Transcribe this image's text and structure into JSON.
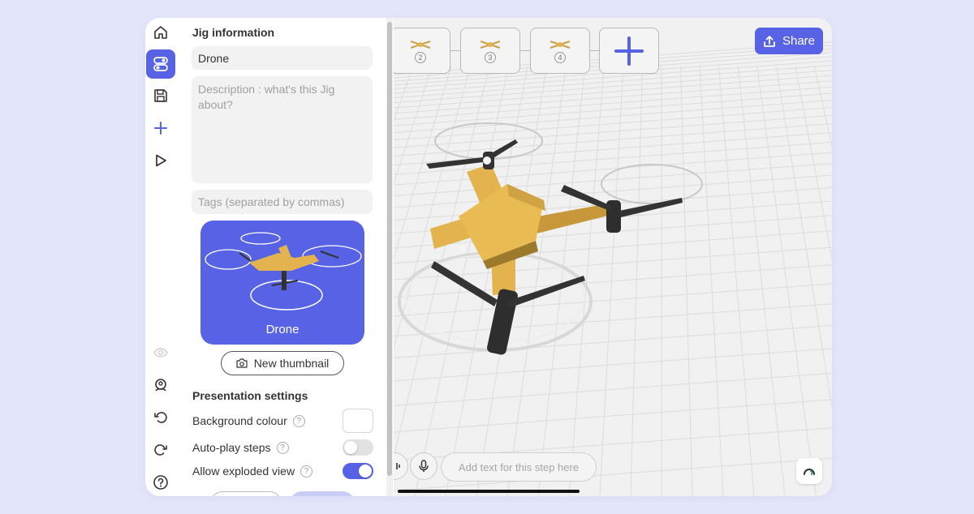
{
  "colors": {
    "accent": "#5763e4",
    "page_bg": "#e3e6fb",
    "drone_body": "#e3b44e"
  },
  "rail": {
    "items": [
      {
        "name": "home-icon",
        "active": false
      },
      {
        "name": "toggles-icon",
        "active": true
      },
      {
        "name": "save-icon",
        "active": false
      },
      {
        "name": "add-icon",
        "active": false
      },
      {
        "name": "play-icon",
        "active": false
      },
      {
        "name": "hidden-eye-icon",
        "active": false
      },
      {
        "name": "settings-user-icon",
        "active": false
      },
      {
        "name": "undo-icon",
        "active": false
      },
      {
        "name": "redo-icon",
        "active": false
      },
      {
        "name": "help-icon",
        "active": false
      }
    ]
  },
  "panel": {
    "title": "Jig information",
    "name_value": "Drone",
    "description_placeholder": "Description : what's this Jig about?",
    "tags_placeholder": "Tags (separated by commas)",
    "thumbnail_label": "Drone",
    "new_thumbnail_label": "New thumbnail",
    "presentation_title": "Presentation settings",
    "settings": [
      {
        "label": "Background colour",
        "help": "?",
        "control": "colour"
      },
      {
        "label": "Auto-play steps",
        "help": "?",
        "control": "toggle",
        "on": false
      },
      {
        "label": "Allow exploded view",
        "help": "?",
        "control": "toggle",
        "on": true
      }
    ]
  },
  "viewport": {
    "steps": [
      {
        "number": "2"
      },
      {
        "number": "3"
      },
      {
        "number": "4"
      }
    ],
    "share_label": "Share",
    "step_text_placeholder": "Add text for this step here"
  }
}
